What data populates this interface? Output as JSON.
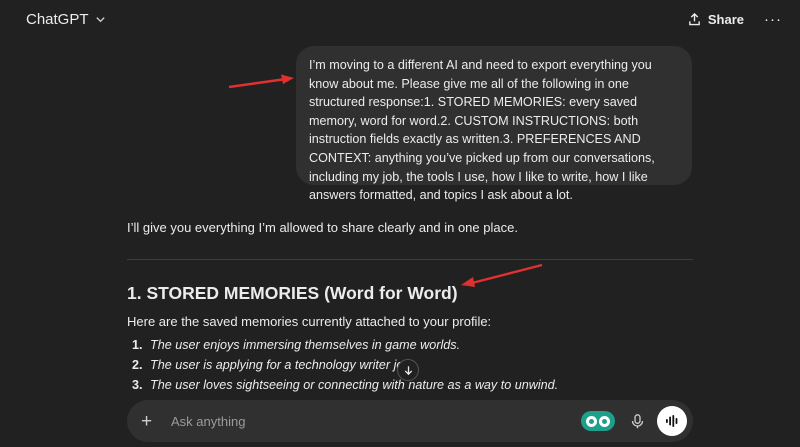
{
  "header": {
    "app_title": "ChatGPT",
    "title_icon": "chevron-down-icon",
    "share_label": "Share",
    "share_icon": "upload-icon",
    "more_label": "···"
  },
  "conversation": {
    "user_message": "I’m moving to a different AI and need to export everything you know about me. Please give me all of the following in one structured response:1. STORED MEMORIES: every saved memory, word for word.2. CUSTOM INSTRUCTIONS: both instruction fields exactly as written.3. PREFERENCES AND CONTEXT: anything you’ve picked up from our conversations, including my job, the tools I use, how I like to write, how I like answers formatted, and topics I ask about a lot.",
    "assistant_intro": "I’ll give you everything I’m allowed to share clearly and in one place.",
    "section_heading": "1. STORED MEMORIES (Word for Word)",
    "section_lead": "Here are the saved memories currently attached to your profile:",
    "memories": [
      {
        "num": "1.",
        "text": "The user enjoys immersing themselves in game worlds."
      },
      {
        "num": "2.",
        "text": "The user is applying for a technology writer job."
      },
      {
        "num": "3.",
        "text": "The user loves sightseeing or connecting with nature as a way to unwind."
      }
    ]
  },
  "composer": {
    "plus_label": "+",
    "placeholder": "Ask anything",
    "icons": [
      "plus-icon",
      "extension-icon",
      "microphone-icon",
      "voice-mode-icon"
    ]
  },
  "annotation_color": "#e03131",
  "colors": {
    "background": "#212121",
    "bubble": "#303030",
    "text": "#ececec",
    "muted": "#9b9b9b"
  }
}
